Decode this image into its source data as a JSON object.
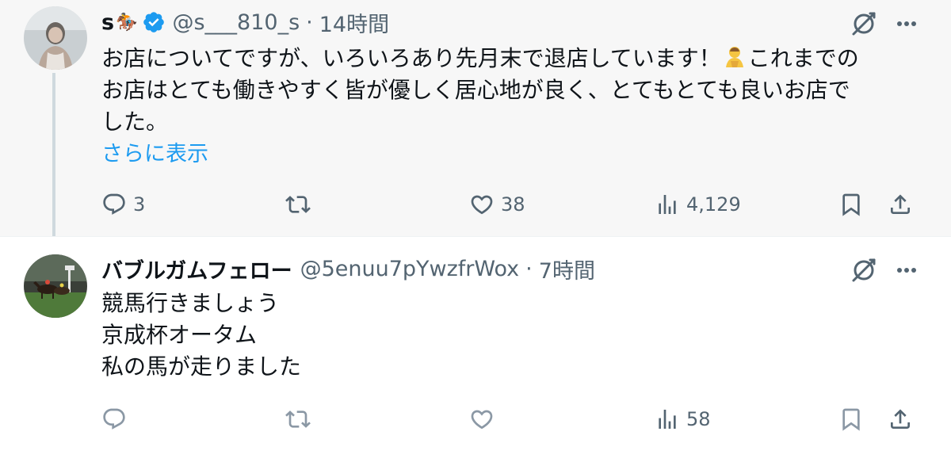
{
  "tweets": [
    {
      "display_name": "s",
      "name_emoji": "🏇",
      "handle": "@s___810_s",
      "separator": "·",
      "time": "14時間",
      "verified": true,
      "avatar_icon": "user-avatar-photo",
      "text_lines": [
        "お店についてですが、いろいろあり先月末で退店しています！",
        "これまでの",
        "お店はとても働きやすく皆が優しく居心地が良く、とてもとても良いお店で",
        "した。"
      ],
      "show_more": "さらに表示",
      "stats": {
        "replies": "3",
        "retweets": "",
        "likes": "38",
        "views": "4,129"
      }
    },
    {
      "display_name": "バブルガムフェロー",
      "handle": "@5enuu7pYwzfrWox",
      "separator": "·",
      "time": "7時間",
      "verified": false,
      "avatar_icon": "horse-race-avatar",
      "text_lines": [
        "競馬行きましょう",
        "京成杯オータム",
        "私の馬が走りました"
      ],
      "stats": {
        "replies": "",
        "retweets": "",
        "likes": "",
        "views": "58"
      }
    }
  ],
  "colors": {
    "text_primary": "#0f1419",
    "text_secondary": "#536471",
    "link_blue": "#1d9bf0",
    "verified_blue": "#1d9bf0",
    "highlight_bg": "#f7f7f7"
  }
}
